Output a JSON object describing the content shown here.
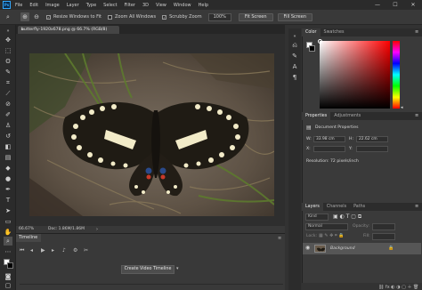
{
  "app": {
    "logo_text": "Ps"
  },
  "menu": [
    "File",
    "Edit",
    "Image",
    "Layer",
    "Type",
    "Select",
    "Filter",
    "3D",
    "View",
    "Window",
    "Help"
  ],
  "window_controls": {
    "minimize": "—",
    "maximize": "☐",
    "close": "✕"
  },
  "options": {
    "resize_windows_label": "Resize Windows to Fit",
    "resize_windows_checked": true,
    "zoom_all_label": "Zoom All Windows",
    "zoom_all_checked": false,
    "scrubby_label": "Scrubby Zoom",
    "scrubby_checked": true,
    "zoom_value": "100%",
    "fit_screen_label": "Fit Screen",
    "fill_screen_label": "Fill Screen"
  },
  "document": {
    "tab_title": "butterfly-1920x678.png @ 66.7% (RGB/8)",
    "close_glyph": "×"
  },
  "status": {
    "zoom": "66.67%",
    "doc_size": "Doc: 1.86M/1.86M"
  },
  "timeline": {
    "tab_label": "Timeline",
    "create_button": "Create Video Timeline"
  },
  "color_panel": {
    "tabs": [
      "Color",
      "Swatches"
    ],
    "foreground": "#ffffff",
    "background": "#000000"
  },
  "properties_panel": {
    "tabs": [
      "Properties",
      "Adjustments"
    ],
    "heading": "Document Properties",
    "w_label": "W:",
    "w_value": "33.98 cm",
    "h_label": "H:",
    "h_value": "22.62 cm",
    "x_label": "X:",
    "y_label": "Y:",
    "resolution": "Resolution: 72 pixels/inch"
  },
  "layers_panel": {
    "tabs": [
      "Layers",
      "Channels",
      "Paths"
    ],
    "kind_label": "Kind",
    "mode_label": "Normal",
    "opacity_label": "Opacity:",
    "lock_label": "Lock:",
    "fill_label": "Fill:",
    "layer_name": "Background"
  },
  "colors": {
    "accent": "#31a8ff",
    "workspace": "#323232"
  }
}
